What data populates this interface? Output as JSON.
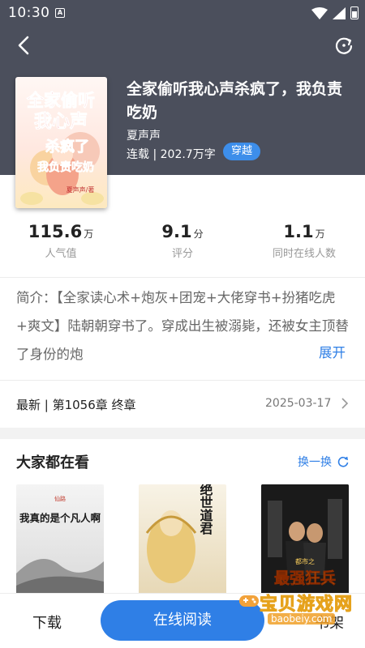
{
  "status_bar": {
    "time": "10:30",
    "notification_icon": "A"
  },
  "nav": {
    "back_icon": "back-arrow-icon",
    "refresh_icon": "refresh-icon"
  },
  "book": {
    "title": "全家偷听我心声杀疯了，我负责吃奶",
    "author": "夏声声",
    "status": "连载",
    "word_count": "202.7万字",
    "tag": "穿越",
    "cover_text": {
      "line1": "全家偷听",
      "line2": "我心声",
      "line3": "杀疯了",
      "line4": "我负责吃奶",
      "author": "夏声声/著"
    }
  },
  "stats": [
    {
      "value": "115.6",
      "unit": "万",
      "label": "人气值"
    },
    {
      "value": "9.1",
      "unit": "分",
      "label": "评分"
    },
    {
      "value": "1.1",
      "unit": "万",
      "label": "同时在线人数"
    }
  ],
  "intro": {
    "text": "简介：【全家读心术+炮灰+团宠+大佬穿书+扮猪吃虎+爽文】陆朝朝穿书了。穿成出生被溺毙，还被女主顶替了身份的炮",
    "expand_label": "展开"
  },
  "latest": {
    "label": "最新 | 第1056章 终章",
    "date": "2025-03-17"
  },
  "recommend": {
    "title": "大家都在看",
    "switch_label": "换一换",
    "books": [
      {
        "cover_title": "我真的是个凡人啊",
        "cover_small": "仙路"
      },
      {
        "cover_title": "绝世道君",
        "cover_small": ""
      },
      {
        "cover_title": "最强狂兵",
        "cover_small": "都市之"
      }
    ]
  },
  "bottom": {
    "download_label": "下载",
    "read_label": "在线阅读",
    "shelf_label": "书架"
  },
  "watermark": {
    "text": "宝贝游戏网",
    "sub": "baobeiy.com"
  },
  "colors": {
    "header_bg": "#4b4f5c",
    "accent": "#2f7fe6",
    "tag_bg": "#3d8eea"
  }
}
